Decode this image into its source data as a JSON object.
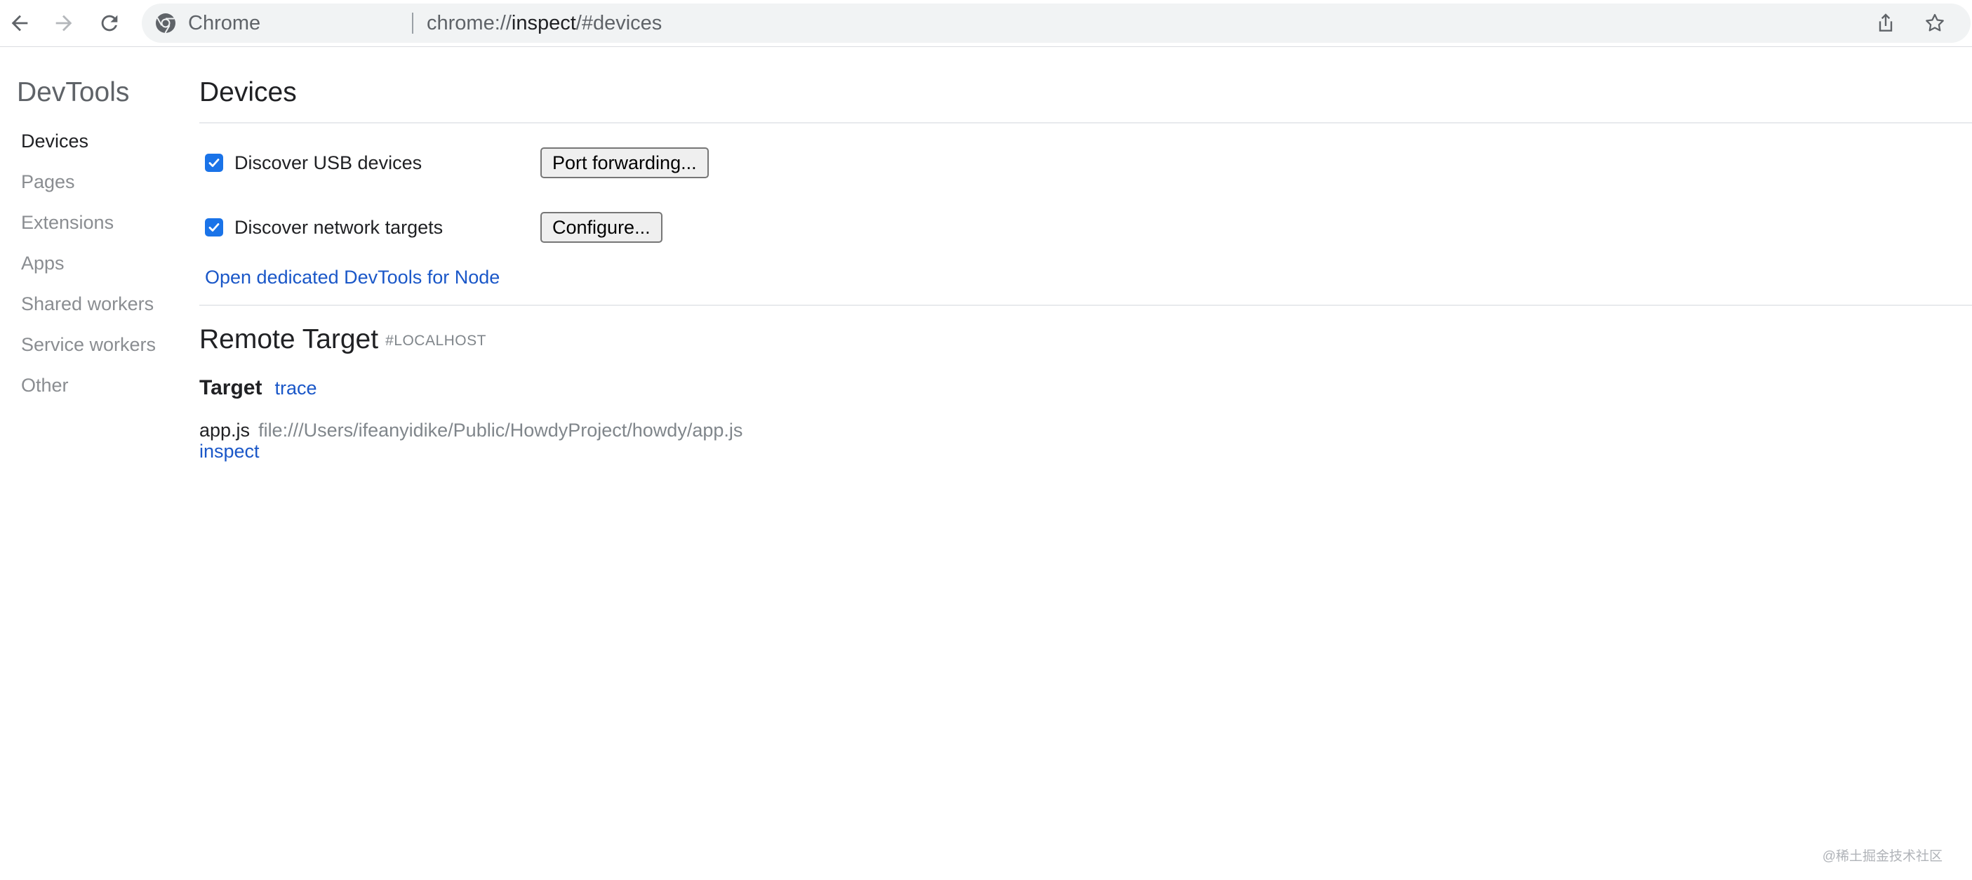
{
  "browser": {
    "origin_chip": "Chrome",
    "url_scheme": "chrome://",
    "url_host": "inspect",
    "url_path": "/#devices"
  },
  "sidebar": {
    "title": "DevTools",
    "items": [
      {
        "label": "Devices",
        "selected": true
      },
      {
        "label": "Pages"
      },
      {
        "label": "Extensions"
      },
      {
        "label": "Apps"
      },
      {
        "label": "Shared workers"
      },
      {
        "label": "Service workers"
      },
      {
        "label": "Other"
      }
    ]
  },
  "devices": {
    "title": "Devices",
    "usb": {
      "label": "Discover USB devices",
      "checked": true,
      "button": "Port forwarding..."
    },
    "network": {
      "label": "Discover network targets",
      "checked": true,
      "button": "Configure..."
    },
    "node_link": "Open dedicated DevTools for Node"
  },
  "remote": {
    "title": "Remote Target",
    "tag": "#LOCALHOST",
    "target_label": "Target",
    "trace_link": "trace",
    "entry": {
      "name": "app.js",
      "path": "file:///Users/ifeanyidike/Public/HowdyProject/howdy/app.js",
      "inspect_link": "inspect"
    }
  },
  "watermark": "@稀土掘金技术社区"
}
